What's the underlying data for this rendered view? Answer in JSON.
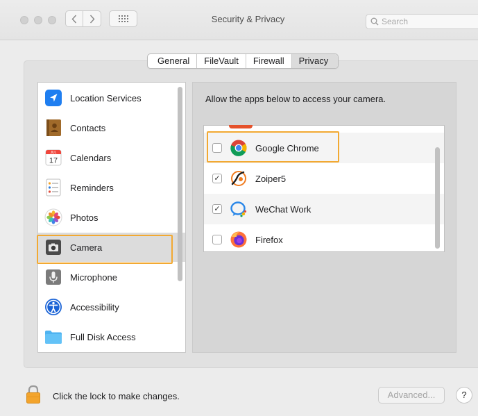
{
  "window": {
    "title": "Security & Privacy"
  },
  "search": {
    "placeholder": "Search"
  },
  "tabs": [
    {
      "label": "General",
      "active": false
    },
    {
      "label": "FileVault",
      "active": false
    },
    {
      "label": "Firewall",
      "active": false
    },
    {
      "label": "Privacy",
      "active": true
    }
  ],
  "sidebar": {
    "items": [
      {
        "label": "Location Services",
        "icon": "location-arrow-icon",
        "selected": false
      },
      {
        "label": "Contacts",
        "icon": "contacts-book-icon",
        "selected": false
      },
      {
        "label": "Calendars",
        "icon": "calendar-icon",
        "selected": false
      },
      {
        "label": "Reminders",
        "icon": "reminders-icon",
        "selected": false
      },
      {
        "label": "Photos",
        "icon": "photos-flower-icon",
        "selected": false
      },
      {
        "label": "Camera",
        "icon": "camera-icon",
        "selected": true
      },
      {
        "label": "Microphone",
        "icon": "microphone-icon",
        "selected": false
      },
      {
        "label": "Accessibility",
        "icon": "accessibility-icon",
        "selected": false
      },
      {
        "label": "Full Disk Access",
        "icon": "folder-icon",
        "selected": false
      }
    ]
  },
  "calendar_icon": {
    "month": "JUL",
    "day": "17"
  },
  "camera": {
    "description": "Allow the apps below to access your camera.",
    "apps": [
      {
        "name": "Google Chrome",
        "checked": false,
        "icon": "chrome-icon"
      },
      {
        "name": "Zoiper5",
        "checked": true,
        "icon": "zoiper-icon"
      },
      {
        "name": "WeChat Work",
        "checked": true,
        "icon": "wechat-work-icon"
      },
      {
        "name": "Firefox",
        "checked": false,
        "icon": "firefox-icon"
      }
    ]
  },
  "footer": {
    "lock_text": "Click the lock to make changes.",
    "advanced_label": "Advanced...",
    "help_label": "?"
  },
  "colors": {
    "highlight": "#f2a932",
    "selected_row": "#dcdcdc",
    "panel_bg": "#e1e1e1"
  }
}
